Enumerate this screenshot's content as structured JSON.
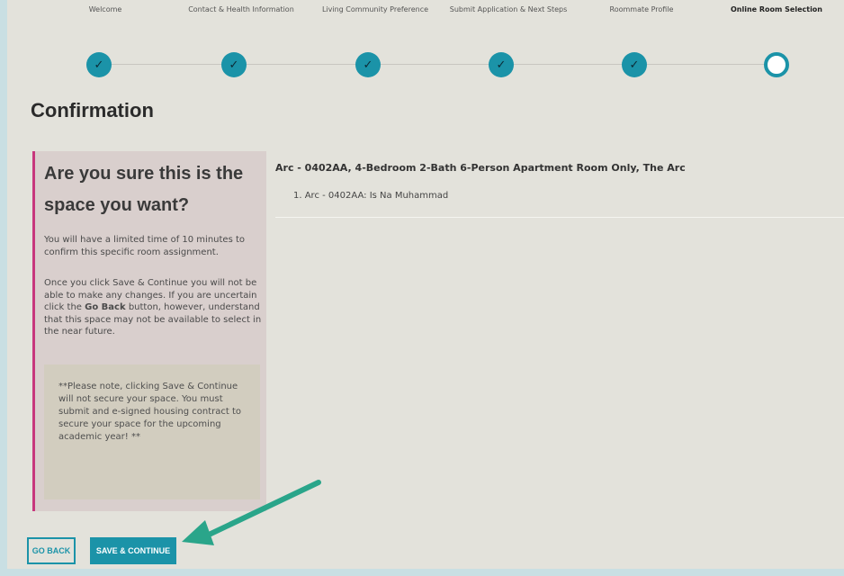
{
  "steps": [
    {
      "label": "Welcome",
      "done": true
    },
    {
      "label": "Contact & Health Information",
      "done": true
    },
    {
      "label": "Living Community Preference",
      "done": true
    },
    {
      "label": "Submit Application & Next Steps",
      "done": true
    },
    {
      "label": "Roommate Profile",
      "done": true
    },
    {
      "label": "Online Room Selection",
      "done": false
    }
  ],
  "page_title": "Confirmation",
  "panel": {
    "heading": "Are you sure this is the space you want?",
    "p1": "You will have a limited time of 10 minutes to confirm this specific room assignment.",
    "p2_before": "Once you click Save & Continue you will not be able to make any changes. If you are uncertain click the ",
    "p2_bold": "Go Back",
    "p2_after": " button, however, understand that this space may not be available to select in the near future.",
    "notice": "**Please note, clicking Save & Continue will not secure your space. You must submit and e-signed housing contract to secure your space for the upcoming academic year! **"
  },
  "selection": {
    "title": "Arc - 0402AA, 4-Bedroom 2-Bath 6-Person Apartment Room Only, The Arc",
    "occupant": "1. Arc - 0402AA: Is Na Muhammad"
  },
  "buttons": {
    "back": "Go Back",
    "save": "Save & Continue"
  },
  "colors": {
    "accent": "#1b93a8",
    "panel_border": "#c7377d",
    "arrow": "#2aa58a"
  },
  "icons": {
    "step_done": "check-icon",
    "step_current": "empty-circle-icon",
    "annotation": "green-arrow"
  }
}
